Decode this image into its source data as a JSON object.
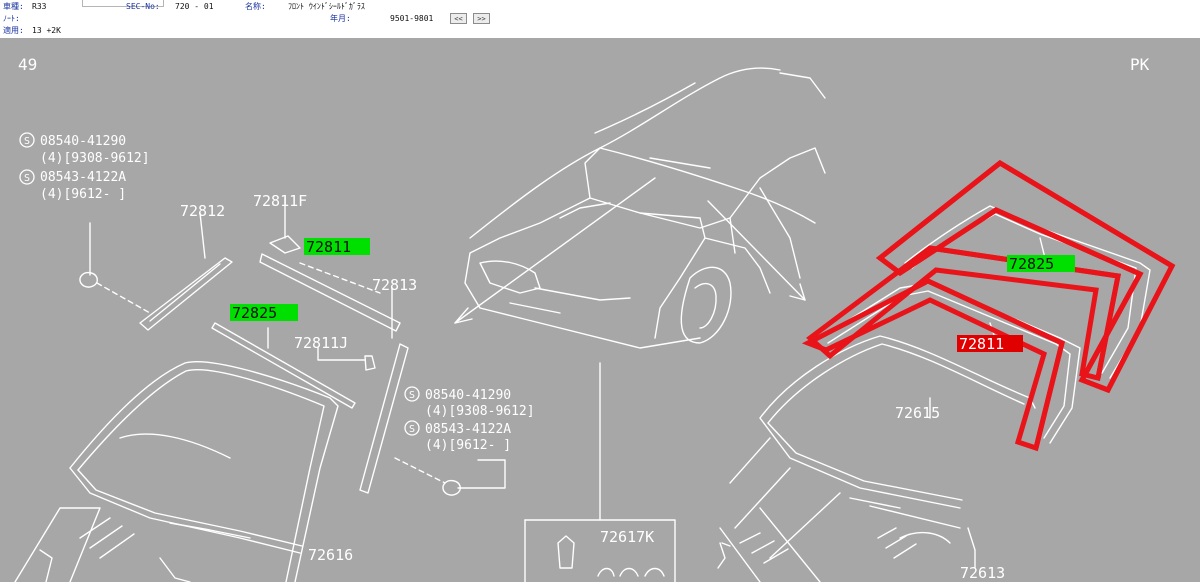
{
  "header": {
    "model_label": "車種:",
    "model_value": "R33",
    "sec_label": "SEC-No:",
    "sec_value": "720 - 01",
    "name_label": "名称:",
    "name_value": "ﾌﾛﾝﾄ ｳｲﾝﾄﾞｼｰﾙﾄﾞｶﾞﾗｽ",
    "note_label": "ﾉｰﾄ:",
    "year_label": "年月:",
    "year_value": "9501-9801",
    "prev_button": "<<",
    "next_button": ">>",
    "apply_label": "適用:",
    "apply_value": "13 +2K"
  },
  "diagram": {
    "corner_left": "49",
    "corner_right": "PK",
    "screw_note_1": {
      "line1": "08540-41290",
      "line2": "(4)[9308-9612]",
      "line3": "08543-4122A",
      "line4": "(4)[9612-      ]"
    },
    "screw_note_2": {
      "line1": "08540-41290",
      "line2": "(4)[9308-9612]",
      "line3": "08543-4122A",
      "line4": "(4)[9612-      ]"
    },
    "part_labels": {
      "p72812": "72812",
      "p72811f": "72811F",
      "p72813": "72813",
      "p72811j": "72811J",
      "p72616": "72616",
      "p72617k": "72617K",
      "p72615": "72615",
      "p72613": "72613"
    },
    "highlight_green": [
      "72811",
      "72825",
      "72825"
    ],
    "highlight_red": "72811",
    "colors": {
      "background": "#a7a7a7",
      "line": "#ffffff",
      "green_highlight": "#00e000",
      "red_highlight": "#e00000",
      "outline_red": "#e8141a"
    }
  }
}
